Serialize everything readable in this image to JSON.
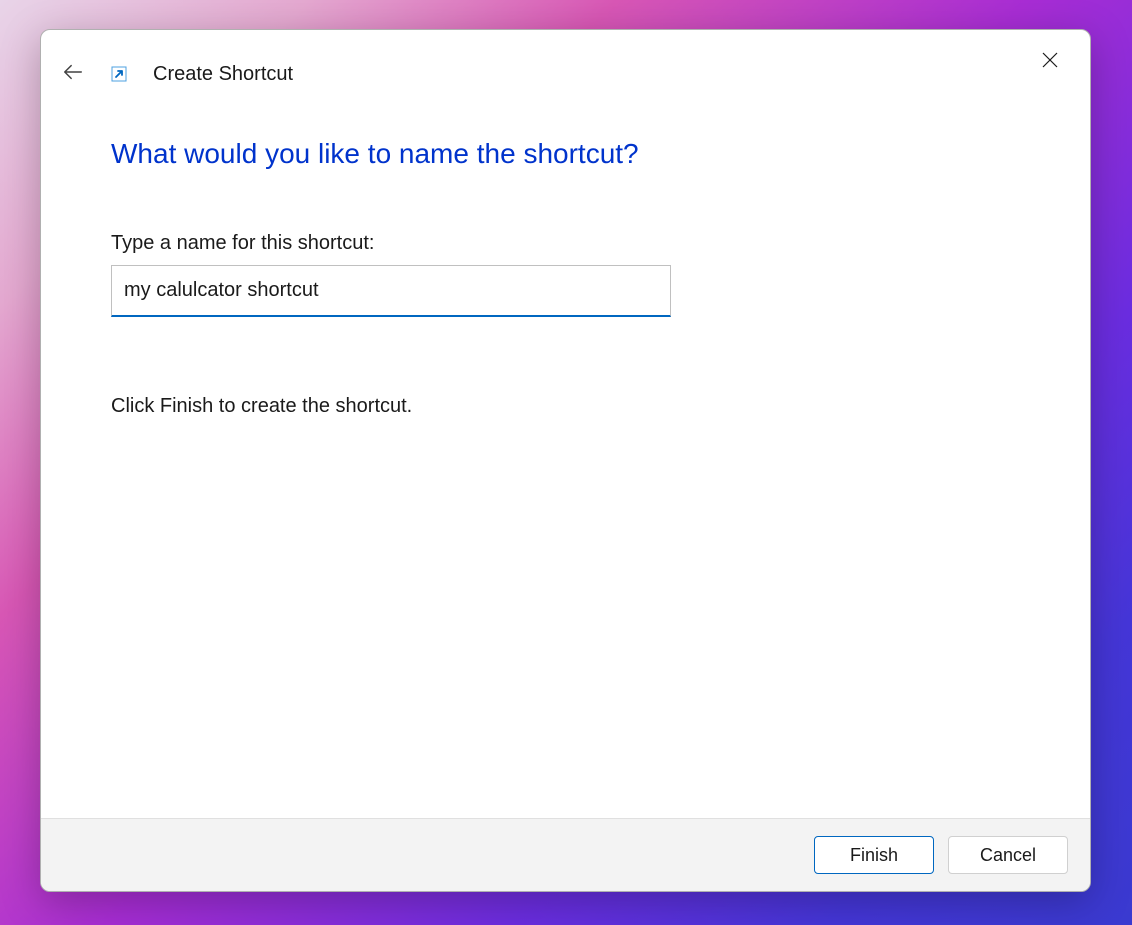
{
  "header": {
    "title": "Create Shortcut"
  },
  "content": {
    "heading": "What would you like to name the shortcut?",
    "input_label": "Type a name for this shortcut:",
    "input_value": "my calulcator shortcut",
    "instruction": "Click Finish to create the shortcut."
  },
  "footer": {
    "primary_label": "Finish",
    "secondary_label": "Cancel"
  }
}
